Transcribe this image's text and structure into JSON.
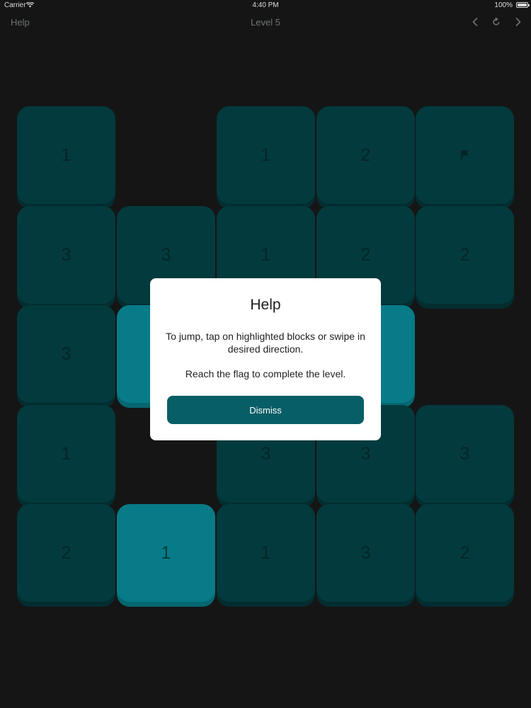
{
  "status_bar": {
    "carrier": "Carrier",
    "time": "4:40 PM",
    "battery": "100%"
  },
  "nav": {
    "help_label": "Help",
    "title": "Level 5"
  },
  "board": {
    "tiles": [
      {
        "label": "1"
      },
      {
        "label": "1"
      },
      {
        "label": "2"
      },
      {
        "label": ""
      },
      {
        "label": "3"
      },
      {
        "label": "3"
      },
      {
        "label": "1"
      },
      {
        "label": "2"
      },
      {
        "label": "2"
      },
      {
        "label": "3"
      },
      {
        "label": ""
      },
      {
        "label": ""
      },
      {
        "label": "1"
      },
      {
        "label": "3"
      },
      {
        "label": "3"
      },
      {
        "label": "3"
      },
      {
        "label": "2"
      },
      {
        "label": "1"
      },
      {
        "label": "1"
      },
      {
        "label": "3"
      },
      {
        "label": "2"
      }
    ]
  },
  "dialog": {
    "title": "Help",
    "message_line1": "To jump, tap on highlighted blocks or swipe in desired direction.",
    "message_line2": "Reach the flag to complete the level.",
    "dismiss_label": "Dismiss"
  },
  "colors": {
    "background": "#151515",
    "tile": "#033a3d",
    "tile_highlight": "#077b87",
    "dialog_button": "#085e66"
  }
}
